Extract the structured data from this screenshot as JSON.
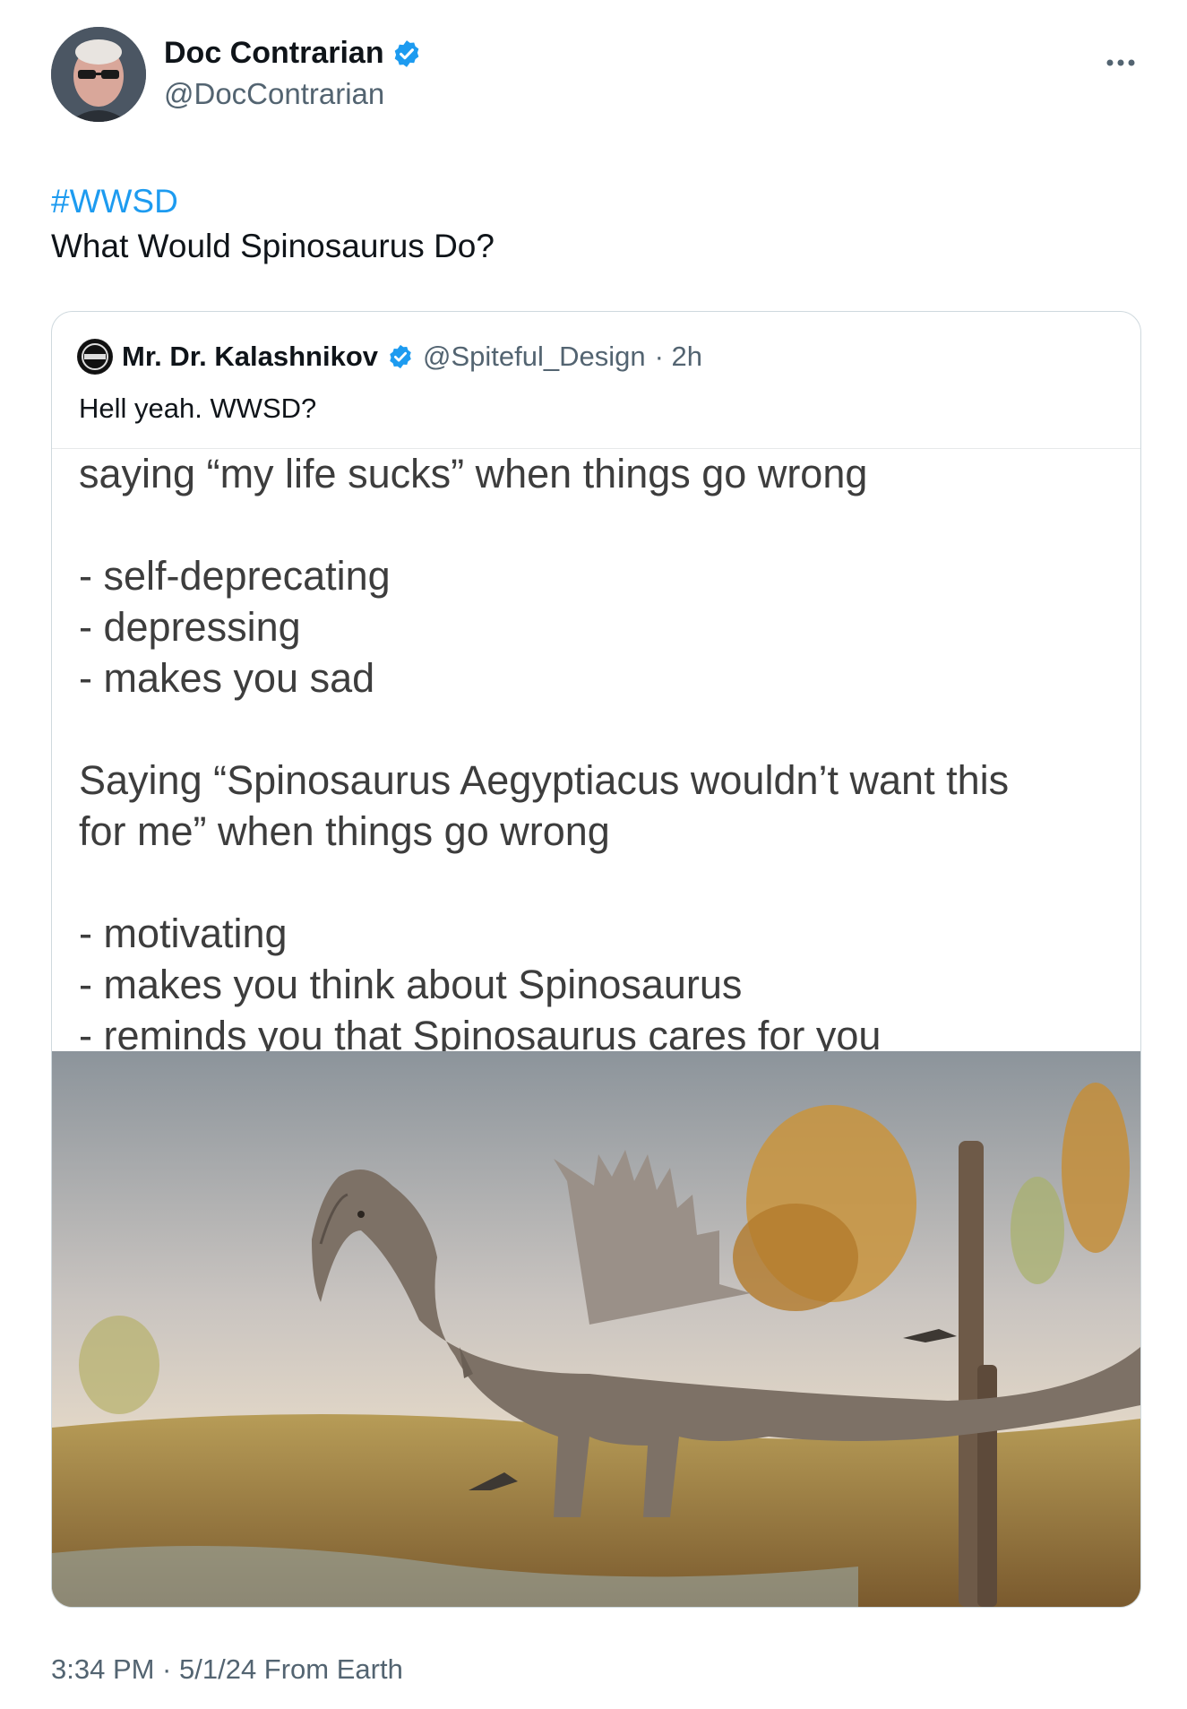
{
  "author": {
    "display_name": "Doc Contrarian",
    "handle": "@DocContrarian",
    "verified": true
  },
  "more_icon": "more-horizontal-icon",
  "tweet": {
    "hashtag": "#WWSD",
    "text": "What Would Spinosaurus Do?"
  },
  "quoted": {
    "display_name": "Mr. Dr. Kalashnikov",
    "handle": "@Spiteful_Design",
    "time": "· 2h",
    "text": "Hell yeah. WWSD?",
    "meme": {
      "line1": "saying “my life sucks” when things go wrong",
      "list1": [
        "- self-deprecating",
        "- depressing",
        "- makes you sad"
      ],
      "line2a": "Saying “Spinosaurus Aegyptiacus wouldn’t want this",
      "line2b": "for me” when things go wrong",
      "list2": [
        "- motivating",
        "- makes you think about Spinosaurus",
        "- reminds you that Spinosaurus cares for you"
      ]
    }
  },
  "footer": {
    "timestamp": "3:34 PM · 5/1/24 From Earth"
  },
  "colors": {
    "link": "#1d9bf0",
    "secondary_text": "#536471",
    "border": "#cfd9de"
  }
}
